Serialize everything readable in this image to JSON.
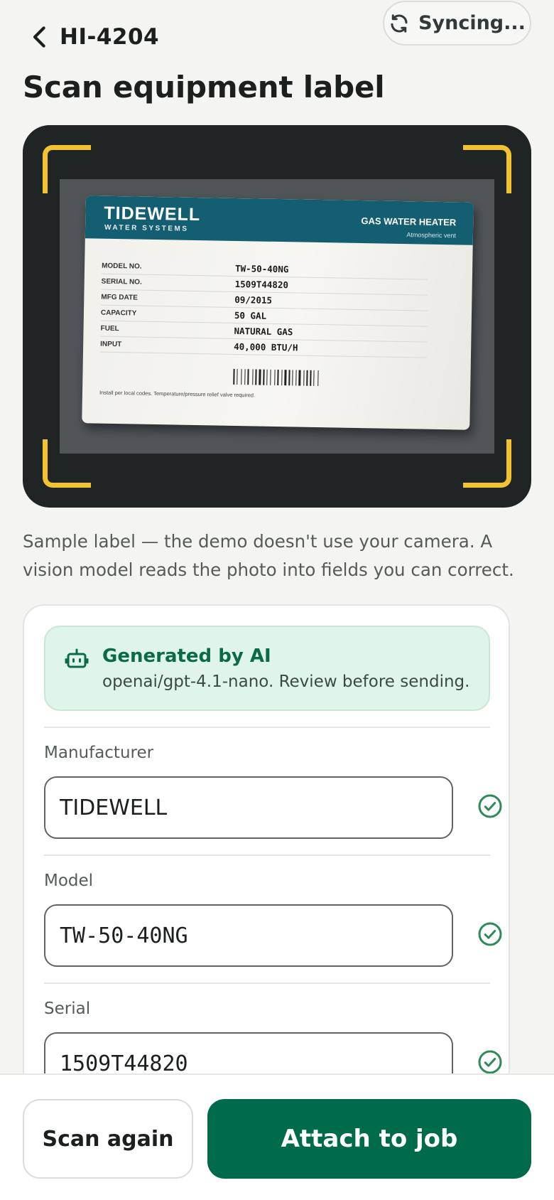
{
  "header": {
    "back_label": "HI-4204",
    "sync_status": "Syncing...",
    "title": "Scan equipment label"
  },
  "label": {
    "brand": "TIDEWELL",
    "brand_sub": "WATER SYSTEMS",
    "product": "GAS WATER HEATER",
    "product_sub": "Atmospheric vent",
    "specs": [
      {
        "key": "MODEL NO.",
        "value": "TW-50-40NG"
      },
      {
        "key": "SERIAL NO.",
        "value": "1509T44820"
      },
      {
        "key": "MFG DATE",
        "value": "09/2015"
      },
      {
        "key": "CAPACITY",
        "value": "50 GAL"
      },
      {
        "key": "FUEL",
        "value": "NATURAL GAS"
      },
      {
        "key": "INPUT",
        "value": "40,000 BTU/H"
      }
    ],
    "fine_print": "Install per local codes. Temperature/pressure relief valve required."
  },
  "caption": "Sample label — the demo doesn't use your camera. A vision model reads the photo into fields you can correct.",
  "ai_banner": {
    "title": "Generated by AI",
    "subtitle": "openai/gpt-4.1-nano. Review before sending."
  },
  "fields": [
    {
      "label": "Manufacturer",
      "value": "TIDEWELL",
      "status": "confirmed"
    },
    {
      "label": "Model",
      "value": "TW-50-40NG",
      "status": "confirmed"
    },
    {
      "label": "Serial",
      "value": "1509T44820",
      "status": "confirmed"
    }
  ],
  "footer": {
    "scan_again": "Scan again",
    "attach": "Attach to job"
  },
  "colors": {
    "primary": "#006b4a",
    "ai_accent": "#0b6b47",
    "ai_bg": "#dff5e9",
    "frame_corner": "#f2c230",
    "label_header": "#145e72"
  },
  "icons": {
    "sync": "sync-icon",
    "back": "chevron-left-icon",
    "ai": "robot-icon",
    "check": "check-circle-icon"
  }
}
